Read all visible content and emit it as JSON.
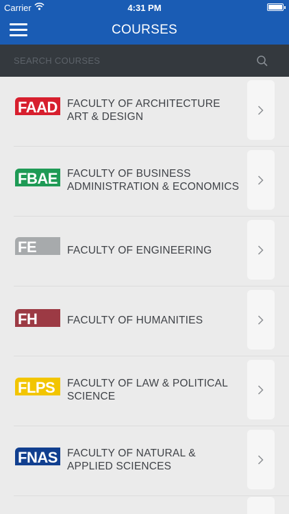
{
  "status_bar": {
    "carrier": "Carrier",
    "time": "4:31 PM"
  },
  "header": {
    "title": "COURSES"
  },
  "search": {
    "placeholder": "SEARCH COURSES",
    "value": ""
  },
  "icons": {
    "menu": "hamburger-icon",
    "search": "search-icon",
    "chevron": "chevron-right-icon"
  },
  "colors": {
    "nav": "#1a5cb4",
    "search_bar": "#34393e",
    "background": "#ebebeb"
  },
  "faculties": [
    {
      "abbr": "FAAD",
      "label": "FACULTY OF ARCHITECTURE ART & DESIGN",
      "color": "#d71f2e"
    },
    {
      "abbr": "FBAE",
      "label": "FACULTY OF BUSINESS ADMINISTRATION & ECONOMICS",
      "color": "#1e9a55"
    },
    {
      "abbr": "FE",
      "label": "FACULTY OF ENGINEERING",
      "color": "#a7aaac"
    },
    {
      "abbr": "FH",
      "label": "FACULTY OF HUMANITIES",
      "color": "#9c3a44"
    },
    {
      "abbr": "FLPS",
      "label": "FACULTY OF LAW & POLITICAL SCIENCE",
      "color": "#f2c500"
    },
    {
      "abbr": "FNAS",
      "label": "FACULTY OF NATURAL & APPLIED SCIENCES",
      "color": "#113f8f"
    }
  ]
}
